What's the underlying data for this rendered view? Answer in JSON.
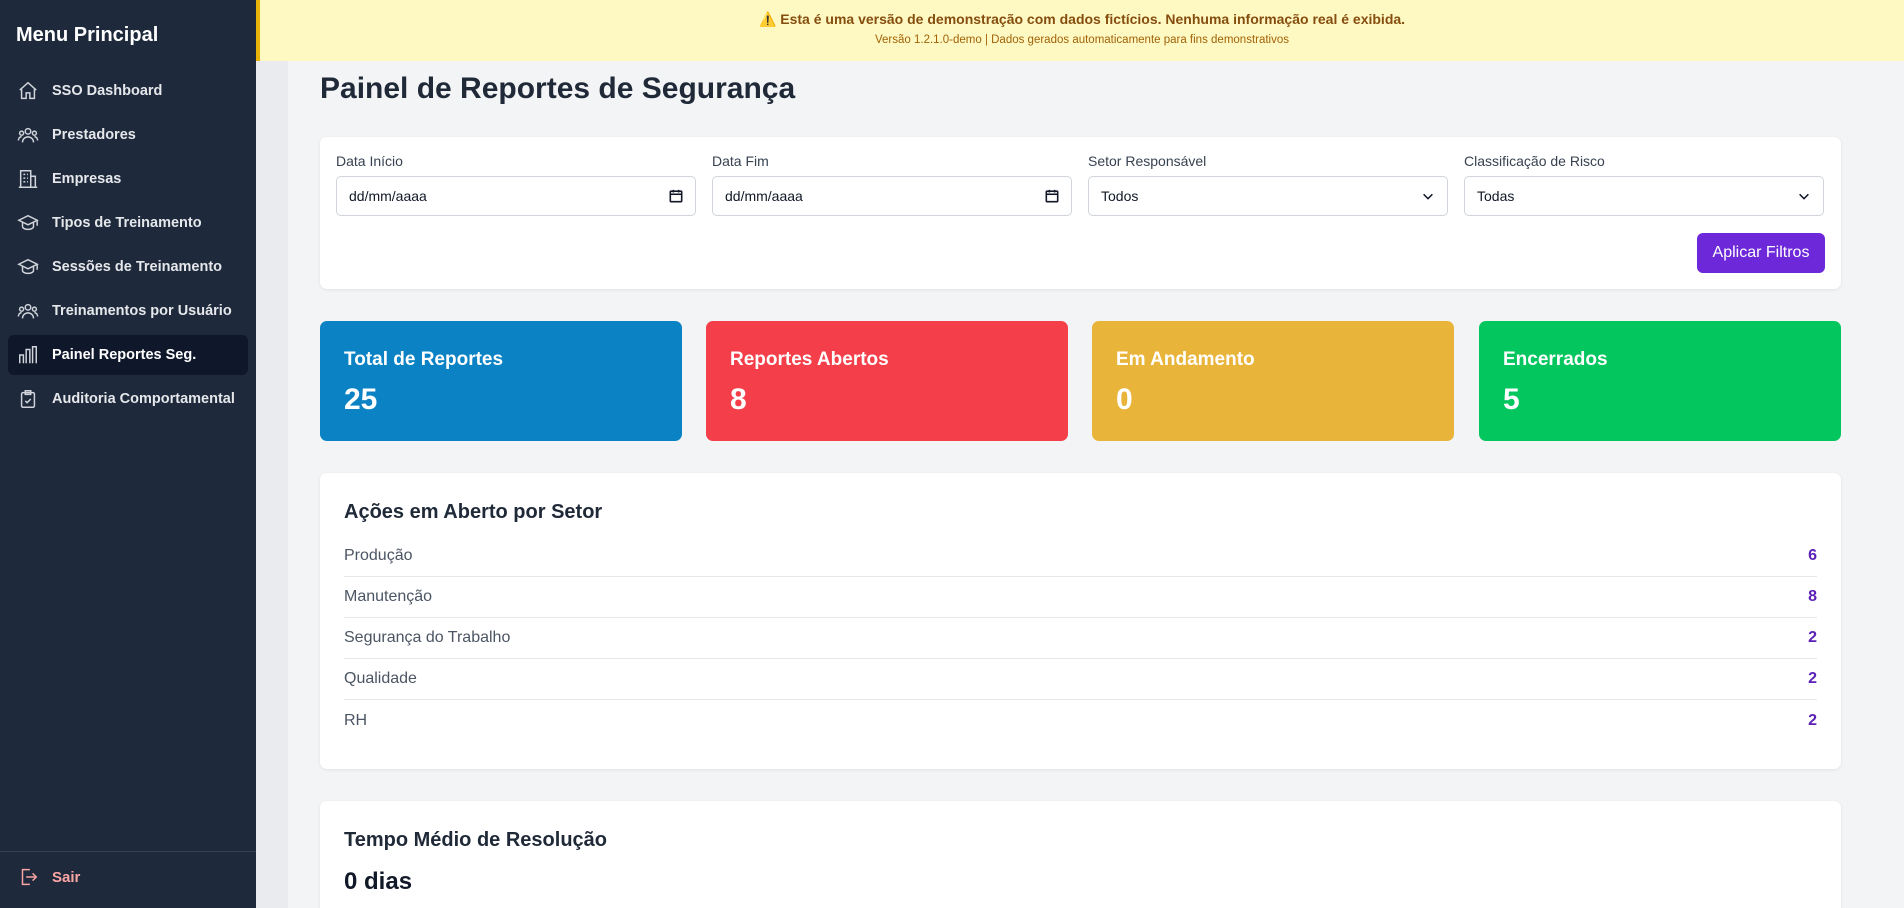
{
  "sidebar": {
    "title": "Menu Principal",
    "items": [
      {
        "label": "SSO Dashboard",
        "icon": "home-icon"
      },
      {
        "label": "Prestadores",
        "icon": "users-icon"
      },
      {
        "label": "Empresas",
        "icon": "building-icon"
      },
      {
        "label": "Tipos de Treinamento",
        "icon": "graduation-cap-icon"
      },
      {
        "label": "Sessões de Treinamento",
        "icon": "graduation-cap-icon"
      },
      {
        "label": "Treinamentos por Usuário",
        "icon": "users-icon"
      },
      {
        "label": "Painel Reportes Seg.",
        "icon": "bar-chart-icon",
        "active": true
      },
      {
        "label": "Auditoria Comportamental",
        "icon": "clipboard-check-icon"
      }
    ],
    "logout_label": "Sair"
  },
  "banner": {
    "message": "⚠️ Esta é uma versão de demonstração com dados fictícios. Nenhuma informação real é exibida.",
    "version": "Versão 1.2.1.0-demo | Dados gerados automaticamente para fins demonstrativos"
  },
  "page": {
    "title": "Painel de Reportes de Segurança"
  },
  "filters": {
    "start_date": {
      "label": "Data Início",
      "value": "dd/mm/aaaa"
    },
    "end_date": {
      "label": "Data Fim",
      "value": "dd/mm/aaaa"
    },
    "sector": {
      "label": "Setor Responsável",
      "value": "Todos"
    },
    "risk": {
      "label": "Classificação de Risco",
      "value": "Todas"
    },
    "apply_label": "Aplicar Filtros"
  },
  "stats": [
    {
      "label": "Total de Reportes",
      "value": "25",
      "color": "#0a82c4"
    },
    {
      "label": "Reportes Abertos",
      "value": "8",
      "color": "#f43f4a"
    },
    {
      "label": "Em Andamento",
      "value": "0",
      "color": "#e9b43a"
    },
    {
      "label": "Encerrados",
      "value": "5",
      "color": "#03c75e"
    }
  ],
  "sectors": {
    "title": "Ações em Aberto por Setor",
    "rows": [
      {
        "name": "Produção",
        "count": "6"
      },
      {
        "name": "Manutenção",
        "count": "8"
      },
      {
        "name": "Segurança do Trabalho",
        "count": "2"
      },
      {
        "name": "Qualidade",
        "count": "2"
      },
      {
        "name": "RH",
        "count": "2"
      }
    ]
  },
  "resolution": {
    "title": "Tempo Médio de Resolução",
    "value": "0 dias"
  }
}
